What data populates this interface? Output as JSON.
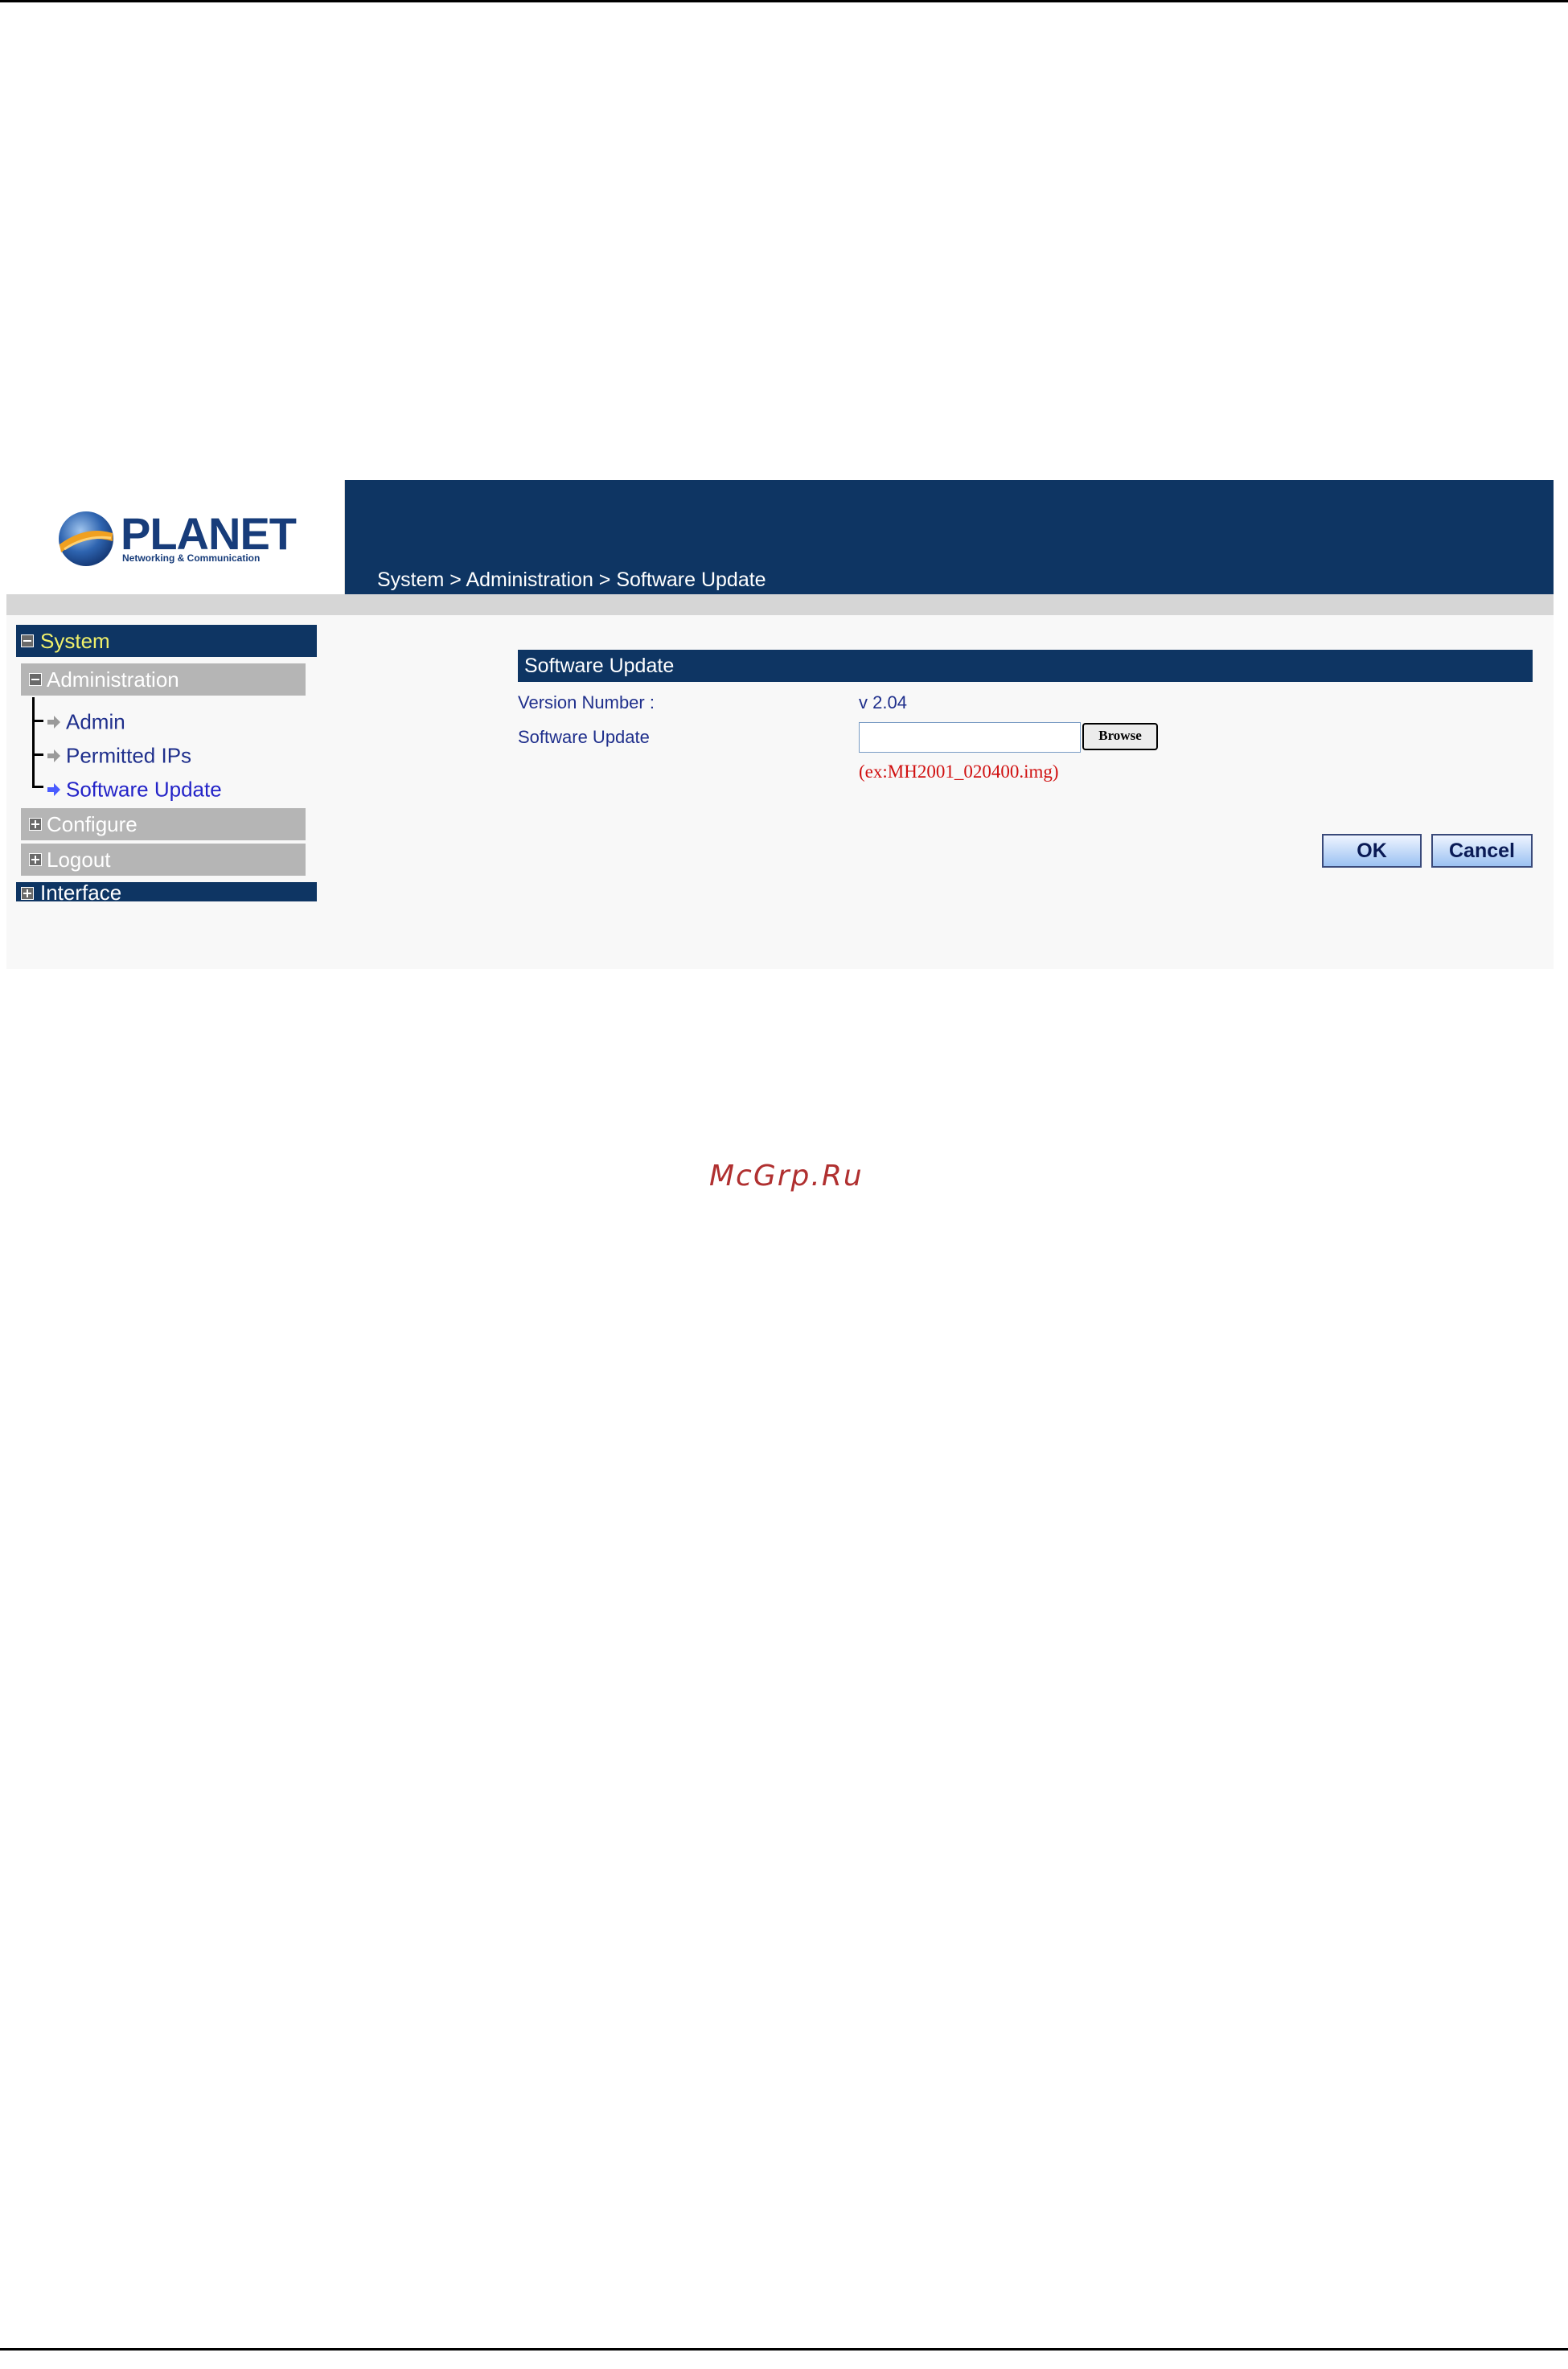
{
  "header": {
    "brand_name": "PLANET",
    "brand_tagline": "Networking & Communication",
    "breadcrumb": "System > Administration > Software Update"
  },
  "sidebar": {
    "system_label": "System",
    "administration_label": "Administration",
    "items": [
      {
        "label": "Admin"
      },
      {
        "label": "Permitted IPs"
      },
      {
        "label": "Software Update"
      }
    ],
    "configure_label": "Configure",
    "logout_label": "Logout",
    "interface_label": "Interface"
  },
  "form": {
    "title": "Software Update",
    "version_label": "Version Number :",
    "version_value": "v 2.04",
    "update_label": "Software Update",
    "file_value": "",
    "browse_label": "Browse",
    "hint": "(ex:MH2001_020400.img)"
  },
  "buttons": {
    "ok": "OK",
    "cancel": "Cancel"
  },
  "watermark": "McGrp.Ru",
  "colors": {
    "header_bg": "#0e3563",
    "sidebar_sub_bg": "#b5b5b5",
    "hint_text": "#d01010",
    "link_text": "#1f2f8c"
  }
}
